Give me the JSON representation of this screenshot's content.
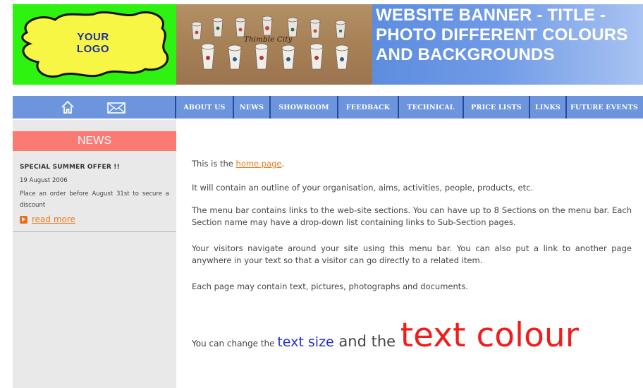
{
  "header": {
    "logo_text": "YOUR\nLOGO",
    "photo_caption": "Thimble  City",
    "banner_title": "WEBSITE BANNER - TITLE - PHOTO DIFFERENT COLOURS AND BACKGROUNDS"
  },
  "menu": {
    "items": [
      "ABOUT US",
      "NEWS",
      "SHOWROOM",
      "FEEDBACK",
      "TECHNICAL",
      "PRICE LISTS",
      "LINKS",
      "FUTURE EVENTS"
    ]
  },
  "sidebar": {
    "news_header": "NEWS",
    "news_title": "SPECIAL SUMMER OFFER !!",
    "news_date": "19 August 2006",
    "news_body": "Place an order before August 31st to secure a discount",
    "read_more": "read more"
  },
  "main": {
    "p1_prefix": "This is the ",
    "p1_link": "home page",
    "p1_suffix": ".",
    "p2": "It will contain an outline of your organisation, aims, activities, people, products, etc.",
    "p3": "The menu bar contains links to the web-site sections. You can have up to 8 Sections on the menu bar. Each Section name may have a drop-down list containing links to Sub-Section pages.",
    "p4": "Your visitors navigate around your site using this menu bar. You can also put a link to another page anywhere in your text so that a visitor can go directly to a related item.",
    "p5": "Each page may contain text, pictures, photographs and documents.",
    "size_demo": {
      "part1": "You can change the ",
      "part2": "text size",
      "part3": " and the ",
      "part4": "text colour"
    }
  },
  "colors": {
    "logo_bg": "#2ef20f",
    "logo_blob": "#f8f645",
    "banner_bg": "#6f9ae6",
    "menu_bg": "#6d95dd",
    "news_header_bg": "#fb7a74",
    "link_orange": "#ef7a20",
    "sidebar_bg": "#e9e9e9",
    "text_blue": "#1f2fd6",
    "text_red": "#f11d1d"
  }
}
